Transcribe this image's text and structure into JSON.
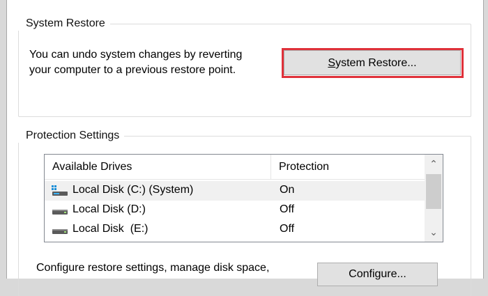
{
  "system_restore": {
    "title": "System Restore",
    "description_line1": "You can undo system changes by reverting",
    "description_line2": "your computer to a previous restore point.",
    "button_label_underlined": "S",
    "button_label_rest": "ystem Restore..."
  },
  "protection": {
    "title": "Protection Settings",
    "columns": [
      "Available Drives",
      "Protection"
    ],
    "drives": [
      {
        "name": "Local Disk (C:) (System)",
        "protection": "On",
        "icon": "system-drive-icon",
        "selected": true
      },
      {
        "name": "Local Disk (D:)",
        "protection": "Off",
        "icon": "drive-icon",
        "selected": false
      },
      {
        "name": "Local Disk  (E:)",
        "protection": "Off",
        "icon": "drive-icon",
        "selected": false
      }
    ],
    "configure_text": "Configure restore settings, manage disk space,",
    "configure_button": "Configure..."
  },
  "colors": {
    "highlight": "#e0313a",
    "drive_blue": "#1a8fd8"
  }
}
